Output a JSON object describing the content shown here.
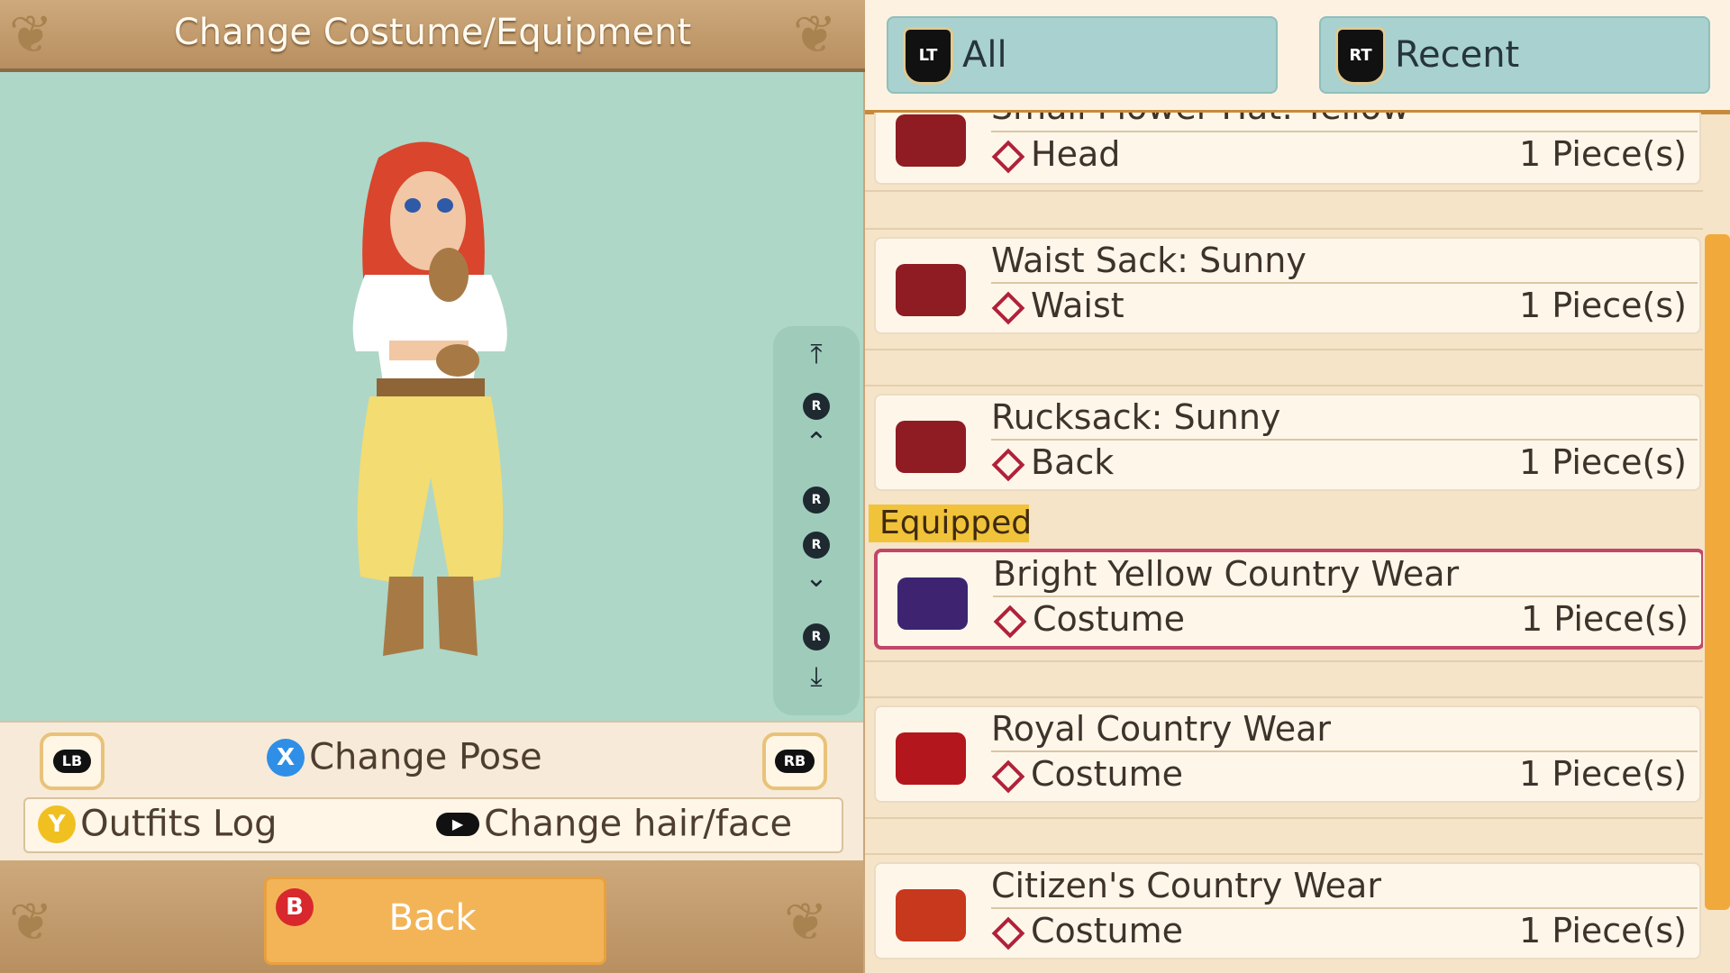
{
  "header": {
    "title": "Change Costume/Equipment"
  },
  "controls": {
    "lb": "LB",
    "rb": "RB",
    "x_button": "X",
    "change_pose": "Change Pose",
    "y_button": "Y",
    "outfits_log": "Outfits Log",
    "change_hair_face": "Change hair/face",
    "b_button": "B",
    "back": "Back",
    "r_label": "R"
  },
  "tabs": [
    {
      "icon": "LT",
      "label": "All"
    },
    {
      "icon": "RT",
      "label": "Recent"
    }
  ],
  "equipped_label": "Equipped",
  "items": [
    {
      "name": "Small Flower Hat: Yellow",
      "slot": "Head",
      "count": "1 Piece(s)",
      "box_color": "#8e1c22"
    },
    {
      "name": "Waist Sack:  Sunny",
      "slot": "Waist",
      "count": "1 Piece(s)",
      "box_color": "#8e1c22"
    },
    {
      "name": "Rucksack: Sunny",
      "slot": "Back",
      "count": "1 Piece(s)",
      "box_color": "#8e1c22"
    },
    {
      "name": "Bright Yellow Country Wear",
      "slot": "Costume",
      "count": "1 Piece(s)",
      "box_color": "#3e2470",
      "equipped": true
    },
    {
      "name": "Royal Country Wear",
      "slot": "Costume",
      "count": "1 Piece(s)",
      "box_color": "#b3161c"
    },
    {
      "name": "Citizen's Country Wear",
      "slot": "Costume",
      "count": "1 Piece(s)",
      "box_color": "#c8381c"
    }
  ],
  "colors": {
    "accent": "#f2a93b",
    "selected_border": "#c0476a",
    "tab_bg": "#a8d1cf",
    "preview_bg": "#aed7c7"
  }
}
